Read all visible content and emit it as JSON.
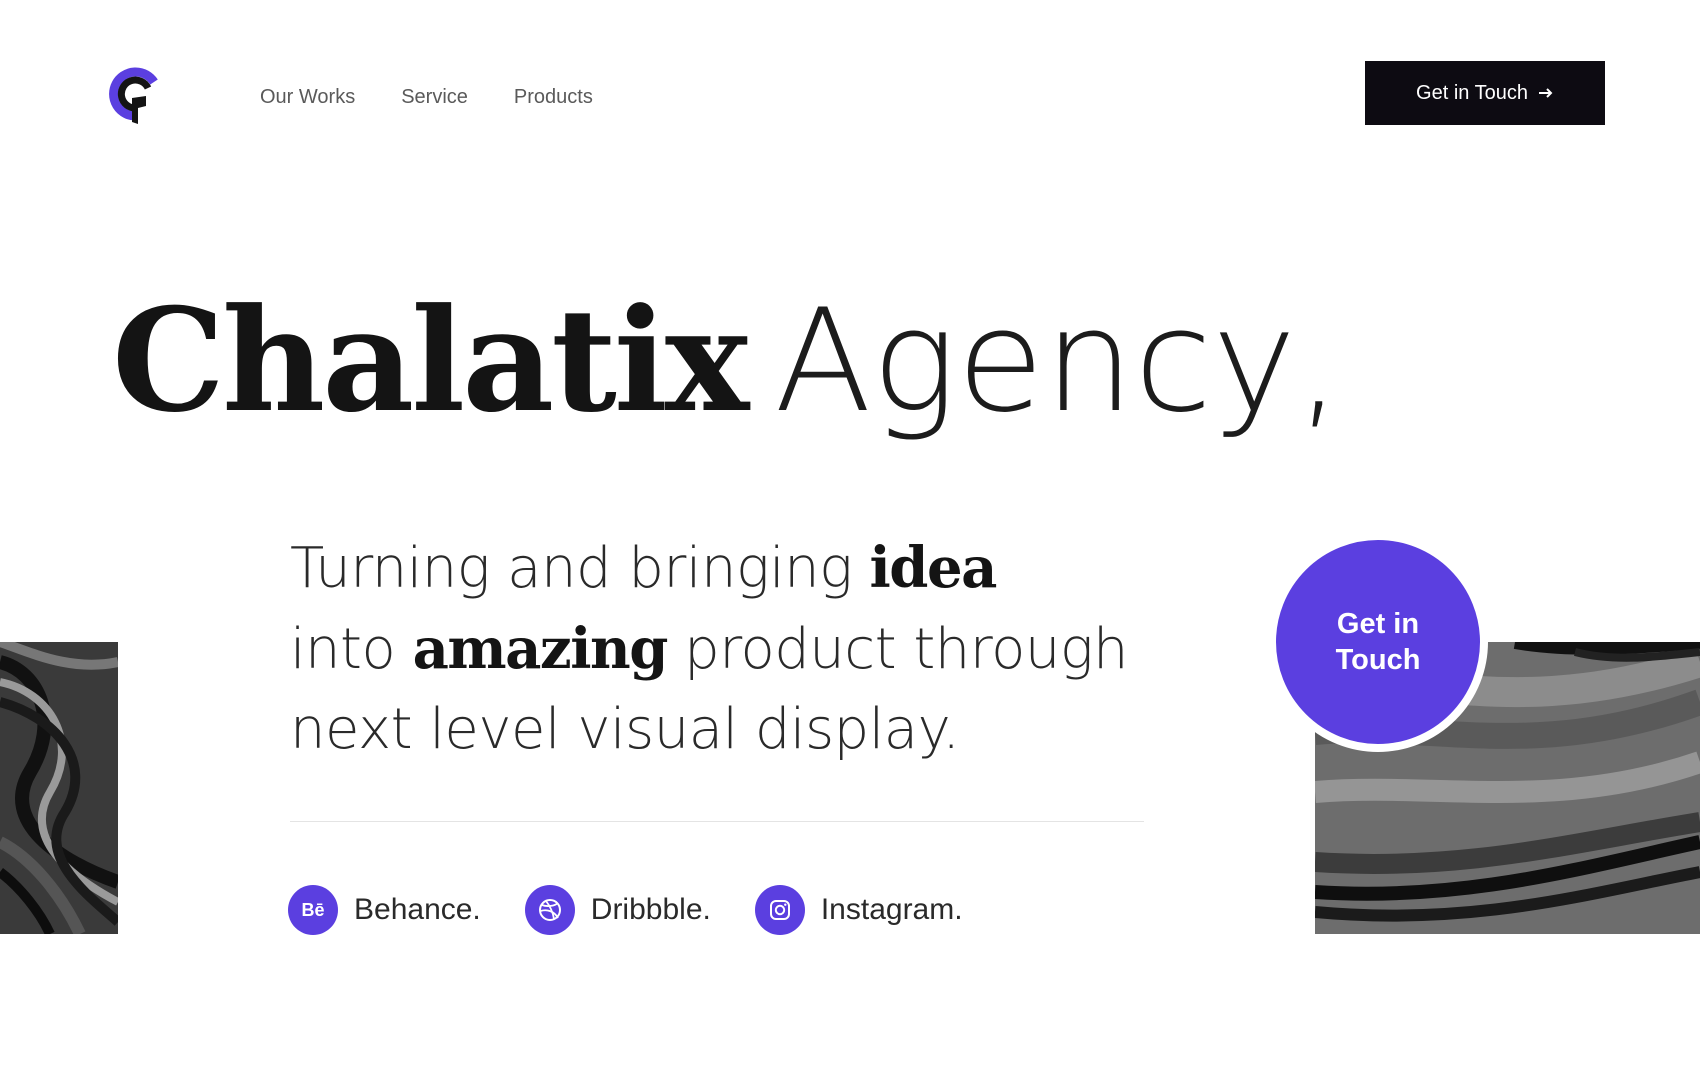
{
  "nav": {
    "items": [
      {
        "label": "Our Works"
      },
      {
        "label": "Service"
      },
      {
        "label": "Products"
      }
    ]
  },
  "header_cta": {
    "label": "Get in Touch",
    "icon": "arrow-right-icon"
  },
  "hero": {
    "brand": "Chalatix",
    "rest": "Agency,",
    "sub": {
      "part1": "Turning and bringing ",
      "em1": "idea",
      "part2": "into ",
      "em2": "amazing",
      "part3": " product through",
      "part4": "next level visual display."
    }
  },
  "circle_cta": {
    "line1": "Get in",
    "line2": "Touch"
  },
  "social": [
    {
      "label": "Behance.",
      "icon": "behance-icon",
      "icon_text": "Bē"
    },
    {
      "label": "Dribbble.",
      "icon": "dribbble-icon"
    },
    {
      "label": "Instagram.",
      "icon": "instagram-icon"
    }
  ],
  "colors": {
    "accent": "#5b3fe0",
    "dark_button": "#0d0b12",
    "text": "#141414"
  }
}
